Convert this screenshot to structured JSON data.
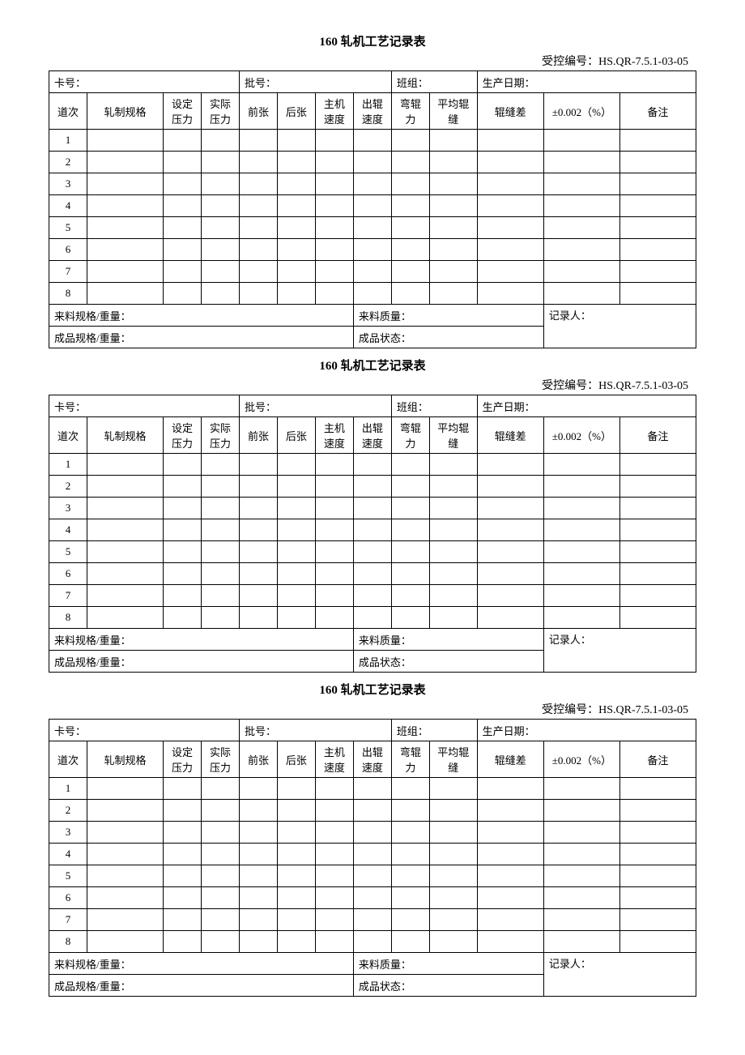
{
  "forms": [
    {
      "title": "160 轧机工艺记录表",
      "control_label": "受控编号：HS.QR-7.5.1-03-05",
      "header_row": {
        "card_no": "卡号：",
        "batch_no": "批号：",
        "team": "班组：",
        "prod_date": "生产日期："
      },
      "col_headers": {
        "pass": "道次",
        "spec": "轧制规格",
        "set_pressure": "设定压力",
        "act_pressure": "实际压力",
        "front_tension": "前张",
        "back_tension": "后张",
        "main_speed": "主机速度",
        "out_speed": "出辊速度",
        "bend_force": "弯辊力",
        "avg_gap": "平均辊缝",
        "gap_diff": "辊缝差",
        "tolerance": "±0.002（%）",
        "remark": "备注"
      },
      "row_nums": [
        "1",
        "2",
        "3",
        "4",
        "5",
        "6",
        "7",
        "8"
      ],
      "footer": {
        "incoming_spec": "来料规格/重量：",
        "incoming_quality": "来料质量：",
        "recorder": "记录人：",
        "finished_spec": "成品规格/重量：",
        "finished_state": "成品状态："
      }
    },
    {
      "title": "160 轧机工艺记录表",
      "control_label": "受控编号：HS.QR-7.5.1-03-05",
      "header_row": {
        "card_no": "卡号：",
        "batch_no": "批号：",
        "team": "班组：",
        "prod_date": "生产日期："
      },
      "col_headers": {
        "pass": "道次",
        "spec": "轧制规格",
        "set_pressure": "设定压力",
        "act_pressure": "实际压力",
        "front_tension": "前张",
        "back_tension": "后张",
        "main_speed": "主机速度",
        "out_speed": "出辊速度",
        "bend_force": "弯辊力",
        "avg_gap": "平均辊缝",
        "gap_diff": "辊缝差",
        "tolerance": "±0.002（%）",
        "remark": "备注"
      },
      "row_nums": [
        "1",
        "2",
        "3",
        "4",
        "5",
        "6",
        "7",
        "8"
      ],
      "footer": {
        "incoming_spec": "来料规格/重量：",
        "incoming_quality": "来料质量：",
        "recorder": "记录人：",
        "finished_spec": "成品规格/重量：",
        "finished_state": "成品状态："
      }
    },
    {
      "title": "160 轧机工艺记录表",
      "control_label": "受控编号：HS.QR-7.5.1-03-05",
      "header_row": {
        "card_no": "卡号：",
        "batch_no": "批号：",
        "team": "班组：",
        "prod_date": "生产日期："
      },
      "col_headers": {
        "pass": "道次",
        "spec": "轧制规格",
        "set_pressure": "设定压力",
        "act_pressure": "实际压力",
        "front_tension": "前张",
        "back_tension": "后张",
        "main_speed": "主机速度",
        "out_speed": "出辊速度",
        "bend_force": "弯辊力",
        "avg_gap": "平均辊缝",
        "gap_diff": "辊缝差",
        "tolerance": "±0.002（%）",
        "remark": "备注"
      },
      "row_nums": [
        "1",
        "2",
        "3",
        "4",
        "5",
        "6",
        "7",
        "8"
      ],
      "footer": {
        "incoming_spec": "来料规格/重量：",
        "incoming_quality": "来料质量：",
        "recorder": "记录人：",
        "finished_spec": "成品规格/重量：",
        "finished_state": "成品状态："
      }
    }
  ]
}
